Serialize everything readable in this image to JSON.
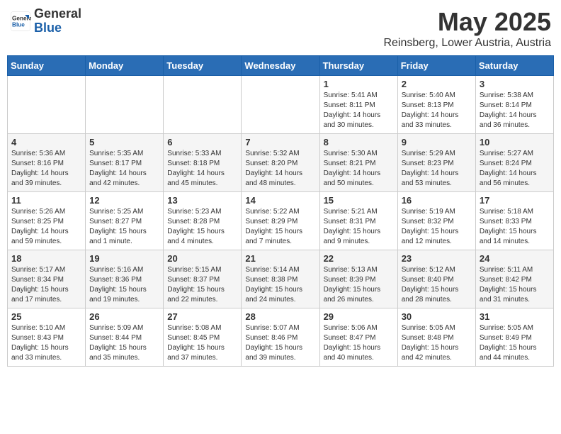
{
  "logo": {
    "general": "General",
    "blue": "Blue"
  },
  "title": {
    "month_year": "May 2025",
    "location": "Reinsberg, Lower Austria, Austria"
  },
  "weekdays": [
    "Sunday",
    "Monday",
    "Tuesday",
    "Wednesday",
    "Thursday",
    "Friday",
    "Saturday"
  ],
  "weeks": [
    [
      {
        "day": "",
        "info": ""
      },
      {
        "day": "",
        "info": ""
      },
      {
        "day": "",
        "info": ""
      },
      {
        "day": "",
        "info": ""
      },
      {
        "day": "1",
        "info": "Sunrise: 5:41 AM\nSunset: 8:11 PM\nDaylight: 14 hours\nand 30 minutes."
      },
      {
        "day": "2",
        "info": "Sunrise: 5:40 AM\nSunset: 8:13 PM\nDaylight: 14 hours\nand 33 minutes."
      },
      {
        "day": "3",
        "info": "Sunrise: 5:38 AM\nSunset: 8:14 PM\nDaylight: 14 hours\nand 36 minutes."
      }
    ],
    [
      {
        "day": "4",
        "info": "Sunrise: 5:36 AM\nSunset: 8:16 PM\nDaylight: 14 hours\nand 39 minutes."
      },
      {
        "day": "5",
        "info": "Sunrise: 5:35 AM\nSunset: 8:17 PM\nDaylight: 14 hours\nand 42 minutes."
      },
      {
        "day": "6",
        "info": "Sunrise: 5:33 AM\nSunset: 8:18 PM\nDaylight: 14 hours\nand 45 minutes."
      },
      {
        "day": "7",
        "info": "Sunrise: 5:32 AM\nSunset: 8:20 PM\nDaylight: 14 hours\nand 48 minutes."
      },
      {
        "day": "8",
        "info": "Sunrise: 5:30 AM\nSunset: 8:21 PM\nDaylight: 14 hours\nand 50 minutes."
      },
      {
        "day": "9",
        "info": "Sunrise: 5:29 AM\nSunset: 8:23 PM\nDaylight: 14 hours\nand 53 minutes."
      },
      {
        "day": "10",
        "info": "Sunrise: 5:27 AM\nSunset: 8:24 PM\nDaylight: 14 hours\nand 56 minutes."
      }
    ],
    [
      {
        "day": "11",
        "info": "Sunrise: 5:26 AM\nSunset: 8:25 PM\nDaylight: 14 hours\nand 59 minutes."
      },
      {
        "day": "12",
        "info": "Sunrise: 5:25 AM\nSunset: 8:27 PM\nDaylight: 15 hours\nand 1 minute."
      },
      {
        "day": "13",
        "info": "Sunrise: 5:23 AM\nSunset: 8:28 PM\nDaylight: 15 hours\nand 4 minutes."
      },
      {
        "day": "14",
        "info": "Sunrise: 5:22 AM\nSunset: 8:29 PM\nDaylight: 15 hours\nand 7 minutes."
      },
      {
        "day": "15",
        "info": "Sunrise: 5:21 AM\nSunset: 8:31 PM\nDaylight: 15 hours\nand 9 minutes."
      },
      {
        "day": "16",
        "info": "Sunrise: 5:19 AM\nSunset: 8:32 PM\nDaylight: 15 hours\nand 12 minutes."
      },
      {
        "day": "17",
        "info": "Sunrise: 5:18 AM\nSunset: 8:33 PM\nDaylight: 15 hours\nand 14 minutes."
      }
    ],
    [
      {
        "day": "18",
        "info": "Sunrise: 5:17 AM\nSunset: 8:34 PM\nDaylight: 15 hours\nand 17 minutes."
      },
      {
        "day": "19",
        "info": "Sunrise: 5:16 AM\nSunset: 8:36 PM\nDaylight: 15 hours\nand 19 minutes."
      },
      {
        "day": "20",
        "info": "Sunrise: 5:15 AM\nSunset: 8:37 PM\nDaylight: 15 hours\nand 22 minutes."
      },
      {
        "day": "21",
        "info": "Sunrise: 5:14 AM\nSunset: 8:38 PM\nDaylight: 15 hours\nand 24 minutes."
      },
      {
        "day": "22",
        "info": "Sunrise: 5:13 AM\nSunset: 8:39 PM\nDaylight: 15 hours\nand 26 minutes."
      },
      {
        "day": "23",
        "info": "Sunrise: 5:12 AM\nSunset: 8:40 PM\nDaylight: 15 hours\nand 28 minutes."
      },
      {
        "day": "24",
        "info": "Sunrise: 5:11 AM\nSunset: 8:42 PM\nDaylight: 15 hours\nand 31 minutes."
      }
    ],
    [
      {
        "day": "25",
        "info": "Sunrise: 5:10 AM\nSunset: 8:43 PM\nDaylight: 15 hours\nand 33 minutes."
      },
      {
        "day": "26",
        "info": "Sunrise: 5:09 AM\nSunset: 8:44 PM\nDaylight: 15 hours\nand 35 minutes."
      },
      {
        "day": "27",
        "info": "Sunrise: 5:08 AM\nSunset: 8:45 PM\nDaylight: 15 hours\nand 37 minutes."
      },
      {
        "day": "28",
        "info": "Sunrise: 5:07 AM\nSunset: 8:46 PM\nDaylight: 15 hours\nand 39 minutes."
      },
      {
        "day": "29",
        "info": "Sunrise: 5:06 AM\nSunset: 8:47 PM\nDaylight: 15 hours\nand 40 minutes."
      },
      {
        "day": "30",
        "info": "Sunrise: 5:05 AM\nSunset: 8:48 PM\nDaylight: 15 hours\nand 42 minutes."
      },
      {
        "day": "31",
        "info": "Sunrise: 5:05 AM\nSunset: 8:49 PM\nDaylight: 15 hours\nand 44 minutes."
      }
    ]
  ]
}
